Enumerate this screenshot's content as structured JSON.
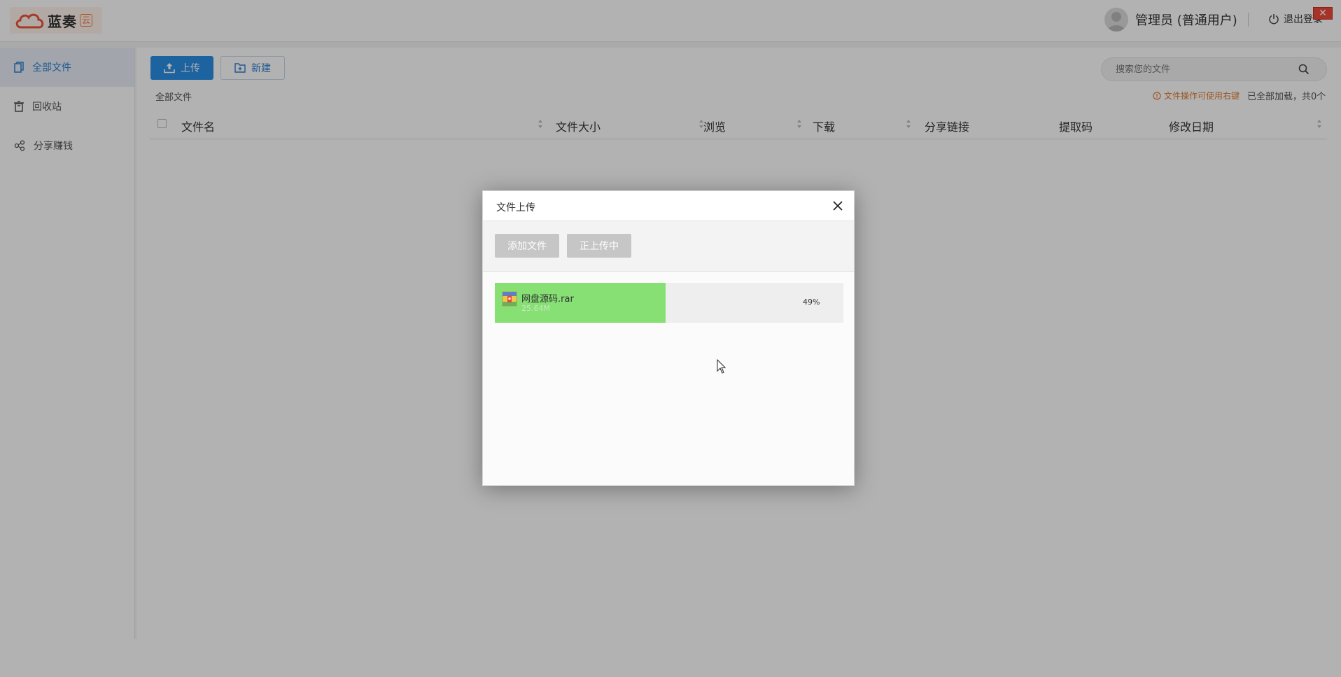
{
  "app": {
    "logo_text": "蓝奏",
    "logo_badge": "云"
  },
  "header": {
    "user_name": "管理员 (普通用户)",
    "logout_label": "退出登录",
    "close_glyph": "✕"
  },
  "sidebar": {
    "items": [
      {
        "label": "全部文件",
        "icon": "files-icon",
        "active": true
      },
      {
        "label": "回收站",
        "icon": "trash-icon",
        "active": false
      },
      {
        "label": "分享赚钱",
        "icon": "share-icon",
        "active": false
      }
    ]
  },
  "toolbar": {
    "upload_label": "上传",
    "new_label": "新建"
  },
  "search": {
    "placeholder": "搜索您的文件"
  },
  "breadcrumb": "全部文件",
  "tip": "文件操作可使用右键",
  "loaded_status": "已全部加载，共0个",
  "table": {
    "columns": [
      "文件名",
      "文件大小",
      "浏览",
      "下载",
      "分享链接",
      "提取码",
      "修改日期"
    ]
  },
  "upload_dialog": {
    "title": "文件上传",
    "add_button": "添加文件",
    "status_button": "正上传中",
    "items": [
      {
        "name": "网盘源码.rar",
        "size": "25.64M",
        "progress": 49,
        "progress_label": "49%"
      }
    ]
  },
  "colors": {
    "accent": "#2a8ee6",
    "progress": "#86e073",
    "tip": "#e07a30"
  }
}
